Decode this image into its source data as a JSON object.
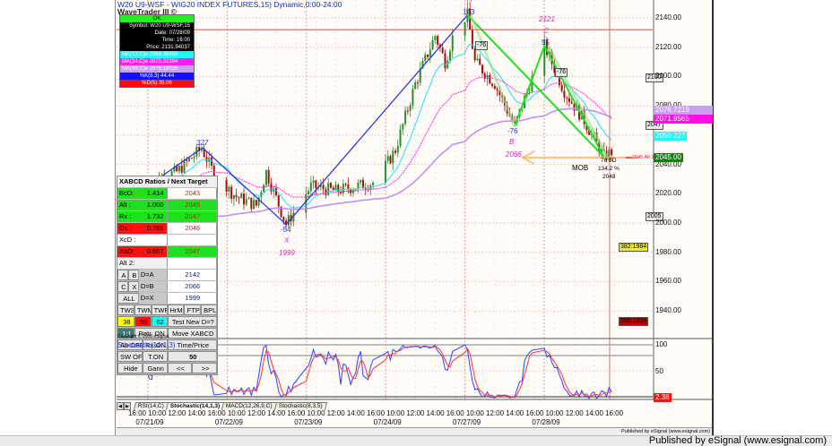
{
  "header": {
    "title": "W20 U9-WSF - WIG20 INDEX FUTURES,15) Dynamic,0:00-24:00",
    "study": "WaveTrader III ©"
  },
  "info_box": {
    "status": "OK",
    "symbol": "Symbol: W20 U9-WSF,15",
    "date": "Date: 07/28/09",
    "time": "Time: 16:00",
    "price": "Price: 2131.94037",
    "ma13": "MA(13,C)e 2064.36453",
    "ma34": "MA(34,C)e 2075.32304",
    "ma89": "MA(89,C)e 2076.18026",
    "k": "%K(8,3) 44.44",
    "d": "%D(5) 35.06"
  },
  "xabcd": {
    "title": "XABCD Ratios / Next Target",
    "rows": [
      {
        "label": "BcD:",
        "value": "1.414",
        "target": "2043"
      },
      {
        "label": "Alt :",
        "value": "1.000",
        "target": "2045"
      },
      {
        "label": "Rx :",
        "value": "1.732",
        "target": "2047"
      },
      {
        "label": "Dx :",
        "value": "0.786",
        "target": "2046"
      },
      {
        "label": "XcD :",
        "value": "",
        "target": ""
      },
      {
        "label": "XaD:",
        "value": "0.667",
        "target": "2047"
      }
    ],
    "alt2": "Alt 2:",
    "points": [
      {
        "a": "A",
        "b": "B",
        "eq": "D=A",
        "v": "2142"
      },
      {
        "a": "C",
        "b": "X",
        "eq": "D=B",
        "v": "2066"
      },
      {
        "a": "ALL",
        "b": "",
        "eq": "D=X",
        "v": "1999"
      }
    ],
    "buttons1": [
      "TWS",
      "TWM",
      "TWF",
      "HrMn",
      "FTP",
      "BPL"
    ],
    "fibs": [
      "38",
      "50",
      "62"
    ],
    "test": "Test New D=?",
    "ratio": "1:1",
    "retr": "Retr. ON",
    "move": "Move XABCD",
    "altoff": "Alt-OFF",
    "rxon": "Rx-ON",
    "timeprice": "Time/Price",
    "swoff": "SW OFF",
    "ton": "T.ON",
    "count": "50",
    "hide": "Hide",
    "gann": "Gann",
    "prev": "<<",
    "next": ">>",
    "copyright": "Copyright © 2006 eSignal."
  },
  "annotations": {
    "p327": "327",
    "pm54": "-54",
    "X": "X",
    "x1999": "1999",
    "p143": "143",
    "A": "A",
    "c2121": "2121",
    "C": "C",
    "p55": "55",
    "m76a": "-76",
    "m76b": "-76",
    "m76c": "-76",
    "B": "B",
    "b2066": "2066",
    "td": "76 TD",
    "pct": "134.2 %",
    "d2048": "2048",
    "mob": "MOB",
    "alt": "2045 Alt 1:1",
    "b2100": "2100",
    "b2047": "2047",
    "b2005": "2005",
    "f382": "382:1984",
    "f500": "500:1934"
  },
  "colors": {
    "ma13": "#22e0f0",
    "ma34": "#ff20e0",
    "ma89": "#c090f0",
    "bull": "#2e8b2e",
    "bear": "#a01010",
    "pattern_xa": "#2030e0",
    "pattern_bcd": "#20e020",
    "stoch_k": "#3040ff",
    "stoch_d": "#ff3030"
  },
  "chart_data": [
    {
      "type": "candlestick",
      "title": "W20 U9-WSF - WIG20 INDEX FUTURES,15) Dynamic,0:00-24:00",
      "ylim": [
        1930,
        2150
      ],
      "y_ticks": [
        "2140.00",
        "2120.00",
        "2100.00",
        "2080.00",
        "2060.00",
        "2040.00",
        "2020.00",
        "2000.00",
        "1980.00",
        "1960.00",
        "1940.00"
      ],
      "last_labels": {
        "ma89": "2076.7219",
        "ma34": "2071.9565",
        "ma13": "2050.227",
        "price": "2045.00"
      },
      "approx_path": [
        [
          "07/20 16:00",
          2025
        ],
        [
          "07/21 10:00",
          2030
        ],
        [
          "07/21 12:00",
          2035
        ],
        [
          "07/21 14:30",
          2051
        ],
        [
          "07/21 16:00",
          2030
        ],
        [
          "07/22 10:00",
          2018
        ],
        [
          "07/22 12:00",
          2012
        ],
        [
          "07/22 13:00",
          2035
        ],
        [
          "07/22 15:00",
          1999
        ],
        [
          "07/22 16:00",
          2010
        ],
        [
          "07/23 09:30",
          2025
        ],
        [
          "07/23 12:00",
          2022
        ],
        [
          "07/23 16:00",
          2028
        ],
        [
          "07/24 10:00",
          2050
        ],
        [
          "07/24 12:00",
          2095
        ],
        [
          "07/24 14:00",
          2128
        ],
        [
          "07/24 15:00",
          2110
        ],
        [
          "07/24 16:00",
          2132
        ],
        [
          "07/27 09:15",
          2142
        ],
        [
          "07/27 10:00",
          2110
        ],
        [
          "07/27 12:00",
          2095
        ],
        [
          "07/27 14:00",
          2066
        ],
        [
          "07/27 15:00",
          2085
        ],
        [
          "07/28 09:00",
          2121
        ],
        [
          "07/28 11:00",
          2090
        ],
        [
          "07/28 13:00",
          2070
        ],
        [
          "07/28 15:00",
          2045
        ],
        [
          "07/28 16:00",
          2050
        ]
      ],
      "pattern": {
        "X": [
          "07/22 15:00",
          1999
        ],
        "A": [
          "07/27 09:15",
          2142
        ],
        "B": [
          "07/27 14:00",
          2066
        ],
        "C": [
          "07/28 09:00",
          2121
        ],
        "D": [
          "07/28 15:00",
          2045
        ]
      },
      "hline": 2131.94,
      "x_ticks": [
        "16:00",
        "10:00",
        "12:00",
        "14:00",
        "16:00",
        "10:00",
        "12:00",
        "14:00",
        "16:00",
        "10:00",
        "12:00",
        "14:00",
        "16:00",
        "10:00",
        "12:00",
        "14:00",
        "16:00",
        "10:00",
        "12:00",
        "14:00",
        "16:00",
        "10:00",
        "12:00",
        "14:00",
        "16:00"
      ],
      "x_dates": [
        "07/21/09",
        "07/22/09",
        "07/23/09",
        "07/24/09",
        "07/27/09",
        "07/28/09"
      ]
    },
    {
      "type": "line",
      "title": "Stochastic(14,1,3)",
      "ylim": [
        0,
        100
      ],
      "y_ticks": [
        "100",
        "50"
      ],
      "last_label": "2.38",
      "series": [
        "%K",
        "%D"
      ]
    }
  ],
  "tabs": [
    "RSI(14,C)",
    "Stochastic(14,1,3)",
    "MACD(12,26,9,C)",
    "Stochastic(8,3,5)"
  ],
  "footer": {
    "inner": "Published by eSignal (www.esignal.com)",
    "outer": "Published by eSignal (www.esignal.com)"
  }
}
